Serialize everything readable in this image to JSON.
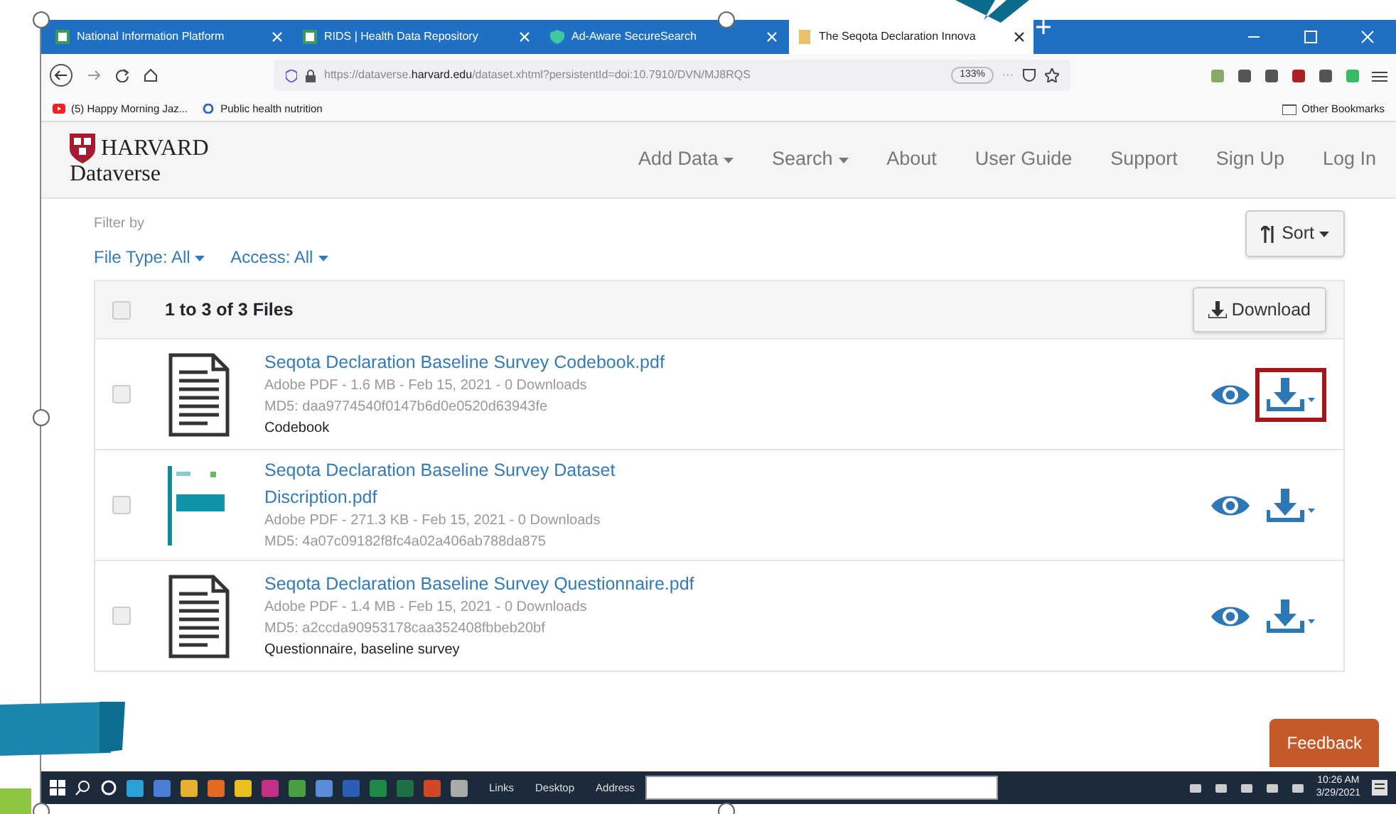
{
  "browser": {
    "tabs": [
      {
        "title": "National Information Platform",
        "selected": false
      },
      {
        "title": "RIDS | Health Data Repository",
        "selected": false
      },
      {
        "title": "Ad-Aware SecureSearch",
        "selected": false
      },
      {
        "title": "The Seqota Declaration Innova",
        "selected": true
      }
    ],
    "address": {
      "prefix": "https://dataverse.",
      "host": "harvard.edu",
      "path": "/dataset.xhtml?persistentId=doi:10.7910/DVN/MJ8RQS"
    },
    "zoom": "133%",
    "more": "···",
    "bookmarks": [
      "(5) Happy Morning Jaz...",
      "Public health nutrition"
    ],
    "other_bookmarks": "Other Bookmarks"
  },
  "site": {
    "brand": "HARVARD",
    "product": "Dataverse",
    "nav": [
      {
        "label": "Add Data",
        "dropdown": true
      },
      {
        "label": "Search",
        "dropdown": true
      },
      {
        "label": "About",
        "dropdown": false
      },
      {
        "label": "User Guide",
        "dropdown": false
      },
      {
        "label": "Support",
        "dropdown": false
      },
      {
        "label": "Sign Up",
        "dropdown": false
      },
      {
        "label": "Log In",
        "dropdown": false
      }
    ]
  },
  "filter": {
    "label": "Filter by",
    "options": [
      "File Type: All",
      "Access: All"
    ],
    "sort": "Sort"
  },
  "files_header": {
    "count": "1 to 3 of 3 Files",
    "download": "Download",
    "checked": false
  },
  "files": [
    {
      "name": "Seqota Declaration Baseline Survey Codebook.pdf",
      "meta": "Adobe PDF - 1.6 MB - Feb 15, 2021 - 0 Downloads",
      "md5": "MD5: daa9774540f0147b6d0e0520d63943fe",
      "description": "Codebook",
      "kind": "document",
      "checked": false,
      "highlighted": true
    },
    {
      "name": "Seqota Declaration Baseline Survey Dataset Discription.pdf",
      "meta": "Adobe PDF - 271.3 KB - Feb 15, 2021 - 0 Downloads",
      "md5": "MD5: 4a07c09182f8fc4a02a406ab788da875",
      "kind": "cover",
      "checked": false,
      "highlighted": false
    },
    {
      "name": "Seqota Declaration Baseline Survey Questionnaire.pdf",
      "meta": "Adobe PDF - 1.4 MB - Feb 15, 2021 - 0 Downloads",
      "md5": "MD5: a2ccda90953178caa352408fbbeb20bf",
      "description": "Questionnaire, baseline survey",
      "kind": "document",
      "checked": false,
      "highlighted": false
    }
  ],
  "feedback": "Feedback",
  "taskbar": {
    "labels": [
      "Links",
      "Desktop",
      "Address"
    ],
    "time": "10:26 AM",
    "date": "3/29/2021"
  }
}
